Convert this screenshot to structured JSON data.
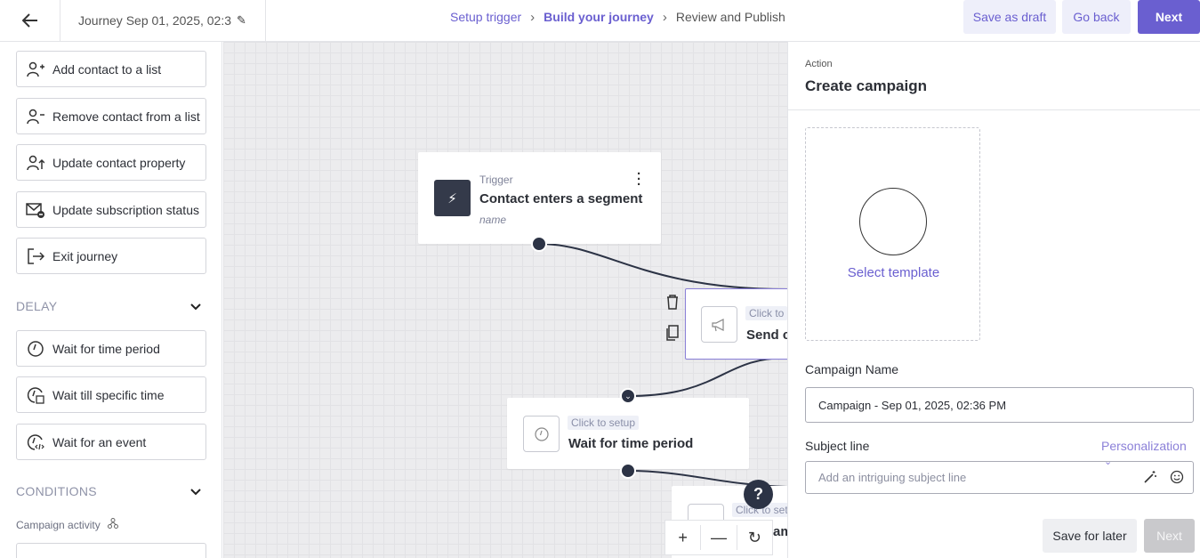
{
  "header": {
    "journey_title": "Journey Sep 01, 2025, 02:3",
    "steps": [
      "Setup trigger",
      "Build your journey",
      "Review and Publish"
    ],
    "save_draft": "Save as draft",
    "go_back": "Go back",
    "next": "Next"
  },
  "sidebar": {
    "actions": [
      {
        "label": "Add contact to a list",
        "icon": "user-plus-icon"
      },
      {
        "label": "Remove contact from a list",
        "icon": "user-minus-icon"
      },
      {
        "label": "Update contact property",
        "icon": "user-up-icon"
      },
      {
        "label": "Update subscription status",
        "icon": "mail-minus-icon"
      },
      {
        "label": "Exit journey",
        "icon": "exit-icon"
      }
    ],
    "delay_title": "DELAY",
    "delays": [
      {
        "label": "Wait for time period",
        "icon": "clock-icon"
      },
      {
        "label": "Wait till specific time",
        "icon": "clock-calendar-icon"
      },
      {
        "label": "Wait for an event",
        "icon": "clock-code-icon"
      }
    ],
    "conditions_title": "CONDITIONS",
    "campaign_activity": "Campaign activity"
  },
  "canvas": {
    "trigger_kicker": "Trigger",
    "trigger_title": "Contact enters a segment",
    "trigger_sub": "name",
    "campaign_tag": "Click to",
    "campaign_title": "Send ca",
    "wait_tag": "Click to setup",
    "wait_title": "Wait for time period",
    "partial_tag": "Click to set",
    "partial_title": "am"
  },
  "panel": {
    "kicker": "Action",
    "title": "Create campaign",
    "select_template": "Select template",
    "campaign_name_label": "Campaign Name",
    "campaign_name_value": "Campaign - Sep 01, 2025, 02:36 PM",
    "subject_label": "Subject line",
    "personalization": "Personalization",
    "subject_placeholder": "Add an intriguing subject line",
    "save_later": "Save for later",
    "next": "Next"
  },
  "colors": {
    "accent": "#6a5fd0",
    "dark_node": "#343a4a"
  }
}
